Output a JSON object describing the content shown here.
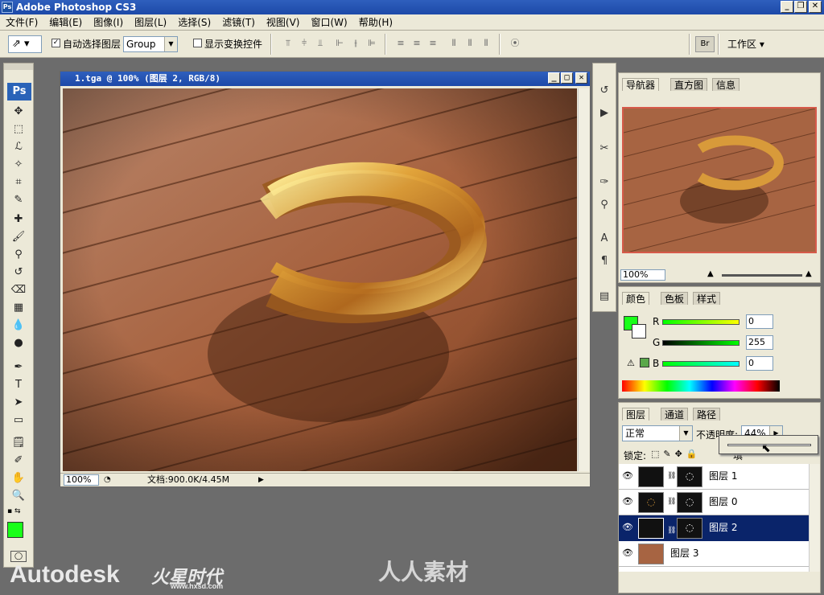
{
  "window": {
    "title": "Adobe Photoshop CS3",
    "icon": "ps-icon",
    "min": "_",
    "max": "❐",
    "close": "✕"
  },
  "menu": [
    "文件(F)",
    "编辑(E)",
    "图像(I)",
    "图层(L)",
    "选择(S)",
    "滤镜(T)",
    "视图(V)",
    "窗口(W)",
    "帮助(H)"
  ],
  "options": {
    "auto_select_label": "自动选择图层",
    "auto_select_value": "Group",
    "show_transform_label": "显示变换控件",
    "workspace": "工作区 ▾"
  },
  "document": {
    "title": "1.tga @ 100% (图层 2, RGB/8)",
    "zoom": "100%",
    "doc_info": "文档:900.0K/4.45M"
  },
  "navigator": {
    "tabs": [
      "导航器",
      "直方图",
      "信息"
    ],
    "zoom": "100%"
  },
  "color": {
    "tabs": [
      "颜色",
      "色板",
      "样式"
    ],
    "r_label": "R",
    "g_label": "G",
    "b_label": "B",
    "r": "0",
    "g": "255",
    "b": "0",
    "fg_color": "#19ff19"
  },
  "layers": {
    "tabs": [
      "图层",
      "通道",
      "路径"
    ],
    "blend_mode": "正常",
    "opacity_label": "不透明度:",
    "opacity": "44%",
    "lock_label": "锁定:",
    "fill_label": "填",
    "items": [
      {
        "name": "图层 1"
      },
      {
        "name": "图层 0"
      },
      {
        "name": "图层 2"
      },
      {
        "name": "图层 3"
      }
    ]
  },
  "watermarks": {
    "autodesk": "Autodesk",
    "hxsd": "火星时代",
    "hxsd_url": "www.hxsd.com",
    "renren": "人人素材"
  }
}
